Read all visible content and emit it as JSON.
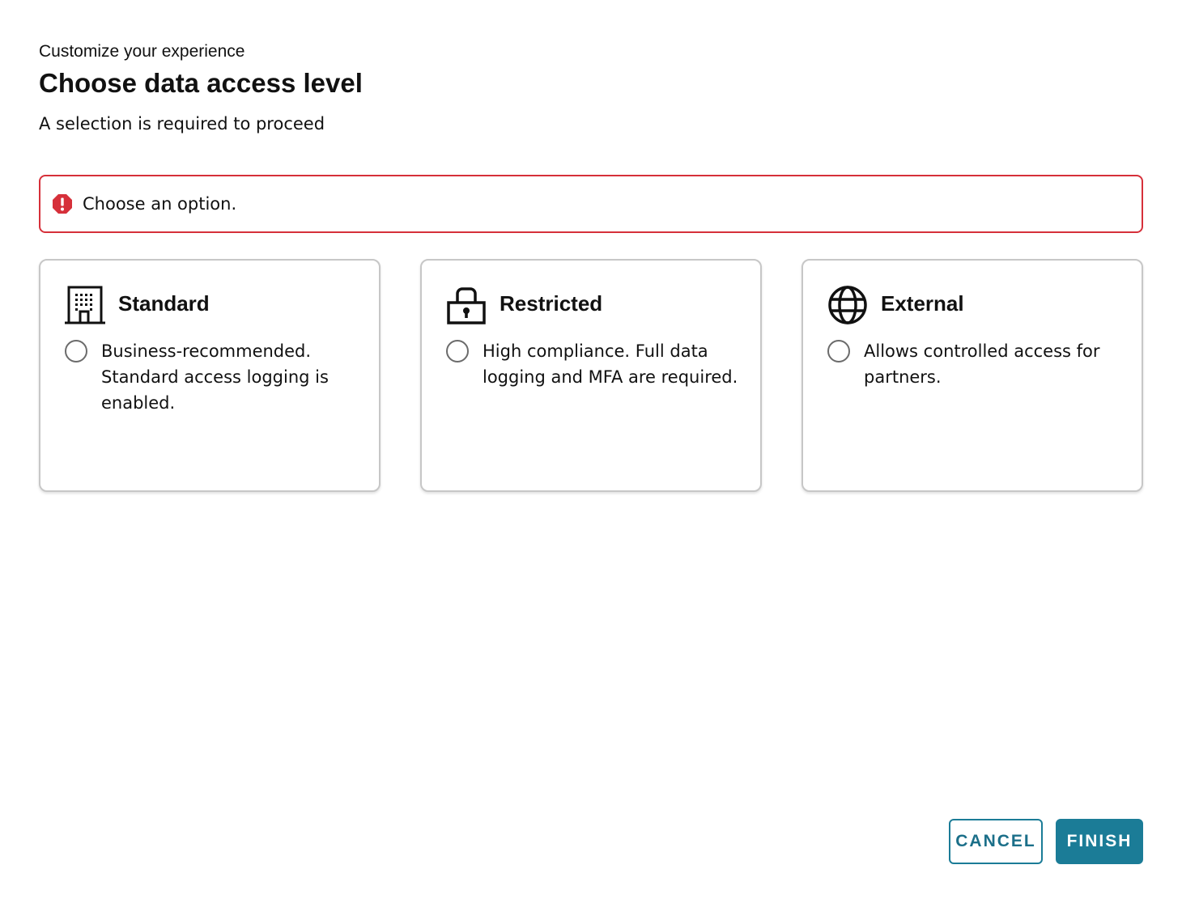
{
  "header": {
    "eyebrow": "Customize your experience",
    "title": "Choose data access level",
    "subtitle": "A selection is required to proceed"
  },
  "alert": {
    "icon": "error-octagon-icon",
    "message": "Choose an option.",
    "color": "#d6303a"
  },
  "options": [
    {
      "icon": "building-icon",
      "title": "Standard",
      "description": "Business-recommended. Standard access logging is enabled.",
      "selected": false
    },
    {
      "icon": "padlock-icon",
      "title": "Restricted",
      "description": "High compliance. Full data logging and MFA are required.",
      "selected": false
    },
    {
      "icon": "globe-icon",
      "title": "External",
      "description": "Allows controlled access for partners.",
      "selected": false
    }
  ],
  "footer": {
    "cancel_label": "CANCEL",
    "finish_label": "FINISH"
  },
  "colors": {
    "accent": "#1b7c97",
    "error": "#d6303a",
    "card_border": "#c7c7c7"
  }
}
